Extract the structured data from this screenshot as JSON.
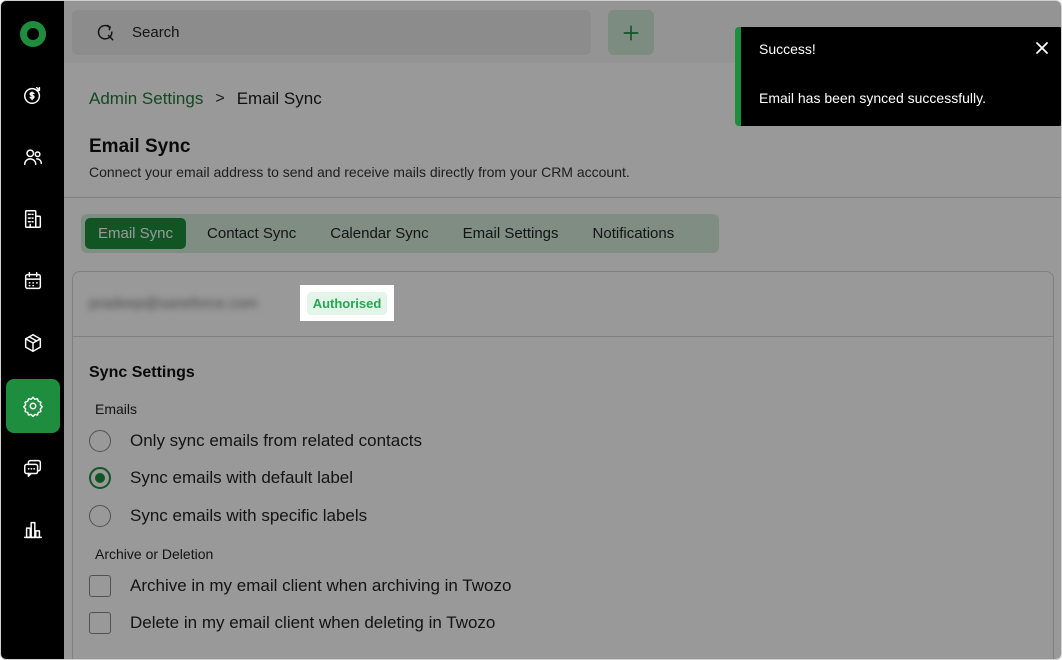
{
  "sidebar": {
    "logo_icon": "twozo-logo-icon",
    "items": [
      {
        "icon": "deals-icon",
        "active": false
      },
      {
        "icon": "contacts-icon",
        "active": false
      },
      {
        "icon": "companies-icon",
        "active": false
      },
      {
        "icon": "calendar-icon",
        "active": false
      },
      {
        "icon": "products-icon",
        "active": false
      },
      {
        "icon": "settings-icon",
        "active": true
      },
      {
        "icon": "chat-icon",
        "active": false
      },
      {
        "icon": "analytics-icon",
        "active": false
      }
    ]
  },
  "topbar": {
    "search_placeholder": "Search",
    "add_icon": "plus-icon"
  },
  "breadcrumb": {
    "parent": "Admin Settings",
    "separator": ">",
    "current": "Email Sync"
  },
  "page": {
    "title": "Email Sync",
    "description": "Connect your email address to send and receive mails directly from your CRM account."
  },
  "tabs": [
    {
      "label": "Email Sync",
      "active": true
    },
    {
      "label": "Contact Sync",
      "active": false
    },
    {
      "label": "Calendar Sync",
      "active": false
    },
    {
      "label": "Email Settings",
      "active": false
    },
    {
      "label": "Notifications",
      "active": false
    }
  ],
  "account": {
    "email": "pradeep@saneforce.com",
    "status": "Authorised"
  },
  "sync_settings": {
    "title": "Sync Settings",
    "emails_label": "Emails",
    "options": [
      {
        "label": "Only sync emails from related contacts",
        "checked": false
      },
      {
        "label": "Sync emails with default label",
        "checked": true
      },
      {
        "label": "Sync emails with specific labels",
        "checked": false
      }
    ],
    "archive_label": "Archive or Deletion",
    "checkboxes": [
      {
        "label": "Archive in my email client when archiving in Twozo",
        "checked": false
      },
      {
        "label": "Delete in my email client when deleting in Twozo",
        "checked": false
      }
    ]
  },
  "toast": {
    "title": "Success!",
    "message": "Email has been synced successfully.",
    "close_icon": "close-icon"
  },
  "colors": {
    "brand_green": "#1e8e3e",
    "sidebar_bg": "#000000",
    "tab_bg": "#d5ecd9",
    "badge_text": "#27a650"
  }
}
